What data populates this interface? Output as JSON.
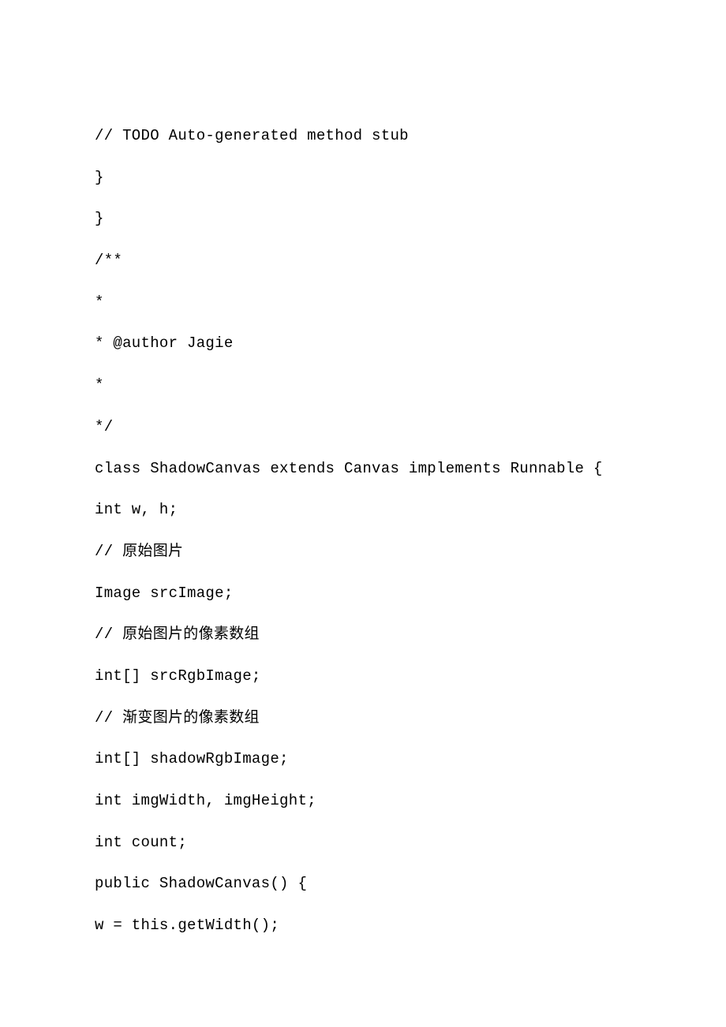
{
  "code": {
    "lines": [
      "// TODO Auto-generated method stub",
      "}",
      "}",
      "/**",
      "*",
      "* @author Jagie",
      "*",
      "*/",
      "class ShadowCanvas extends Canvas implements Runnable {",
      "int w, h;",
      "// 原始图片",
      "Image srcImage;",
      "// 原始图片的像素数组",
      "int[] srcRgbImage;",
      "// 渐变图片的像素数组",
      "int[] shadowRgbImage;",
      "int imgWidth, imgHeight;",
      "int count;",
      "public ShadowCanvas() {",
      "w = this.getWidth();"
    ]
  }
}
